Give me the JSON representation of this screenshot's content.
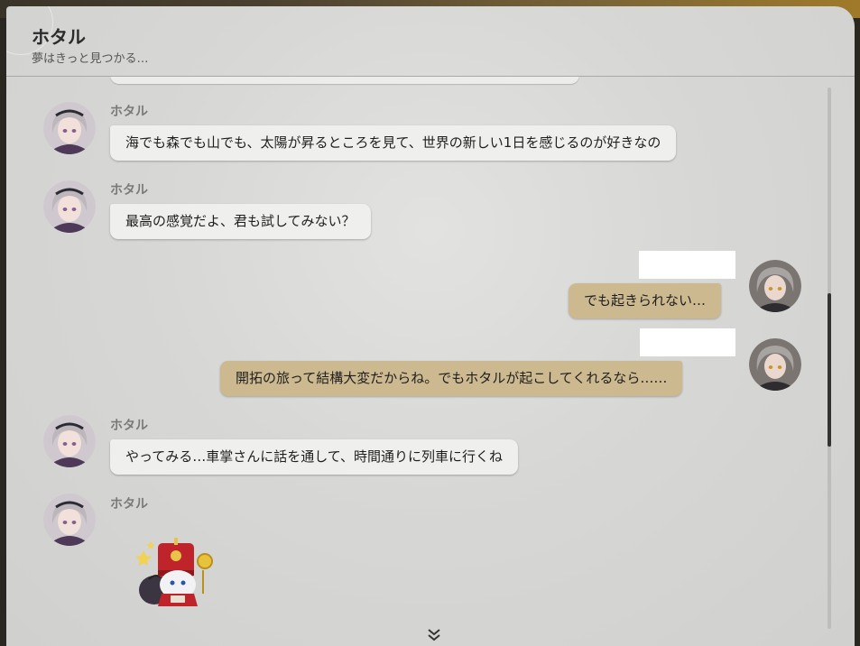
{
  "chat": {
    "title": "ホタル",
    "subtitle": "夢はきっと見つかる…"
  },
  "messages": [
    {
      "side": "left",
      "sender": "ホタル",
      "text": "海でも森でも山でも、太陽が昇るところを見て、世界の新しい1日を感じるのが好きなの"
    },
    {
      "side": "left",
      "sender": "ホタル",
      "text": "最高の感覚だよ、君も試してみない？"
    },
    {
      "side": "right",
      "sender": "",
      "text": "でも起きられない…"
    },
    {
      "side": "right",
      "sender": "",
      "text": "開拓の旅って結構大変だからね。でもホタルが起こしてくれるなら……"
    },
    {
      "side": "left",
      "sender": "ホタル",
      "text": "やってみる…車掌さんに話を通して、時間通りに列車に行くね"
    },
    {
      "side": "left",
      "sender": "ホタル",
      "sticker": "pom-pom-sticker"
    }
  ],
  "colors": {
    "panel_bg": "#d8d8d6",
    "left_bubble": "#efefed",
    "right_bubble": "#cdb98f",
    "text": "#1f1f1f",
    "sender": "#7a7a7a"
  },
  "icons": {
    "scroll_more": "double-chevron-down-icon"
  }
}
